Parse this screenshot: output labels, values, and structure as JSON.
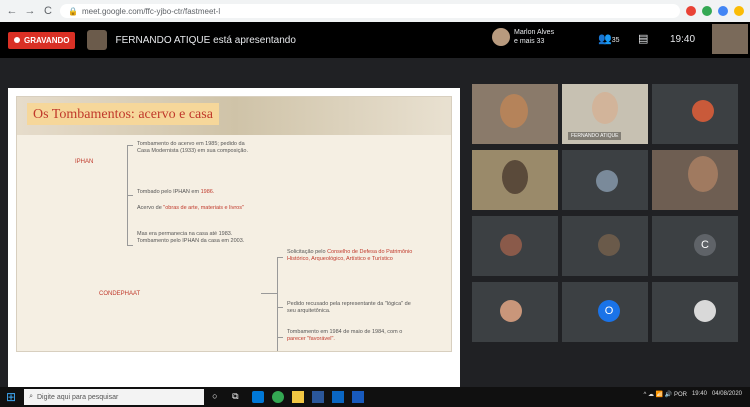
{
  "browser": {
    "url": "meet.google.com/ffc-yjbo-ctr/fastmeet-l",
    "nav_back": "←",
    "nav_forward": "→",
    "nav_reload": "C",
    "ext_colors": [
      "#e94235",
      "#34a853",
      "#4285f4",
      "#fbbc05"
    ]
  },
  "meet": {
    "recording_label": "GRAVANDO",
    "presenting_text": "FERNANDO ATIQUE está apresentando",
    "viewer_line1": "Marlon Alves",
    "viewer_line2": "e mais 33",
    "people_count": "35",
    "clock": "19:40",
    "chat_icon": "chat-icon",
    "people_icon": "people-icon"
  },
  "slide": {
    "title": "Os Tombamentos: acervo e casa",
    "left_label_1": "IPHAN",
    "left_label_2": "CONDEPHAAT",
    "block1": "Tombamento do acervo em 1985; pedido da Casa Modernista (1933) em sua composição.",
    "block2_prefix": "Tombado pelo IPHAN em",
    "block2_red": "1986.",
    "block3_prefix": "Acervo de",
    "block3_red": "\"obras de arte, materiais e livros\"",
    "block4": "Mas era permanecia na casa até 1983. Tombamento pelo IPHAN da casa em 2003.",
    "block5_prefix": "Solicitação pelo",
    "block5_red": "Conselho de Defesa do Patrimônio Histórico, Arqueológico, Artístico e Turístico",
    "block6": "Pedido recusado pela representante da \"lógica\" de seu arquitetônica.",
    "block7_prefix": "Tombamento em 1984 de maio de 1984, com o",
    "block7_red": "parecer \"favorável\"."
  },
  "participants": {
    "tile2_name": "FERNANDO ATIQUE",
    "c_initial": "C",
    "o_initial": "O"
  },
  "taskbar": {
    "search_placeholder": "Digite aqui para pesquisar",
    "tray_text": "^ ☁ 📶 🔊 POR",
    "time": "19:40",
    "date": "04/08/2020"
  }
}
